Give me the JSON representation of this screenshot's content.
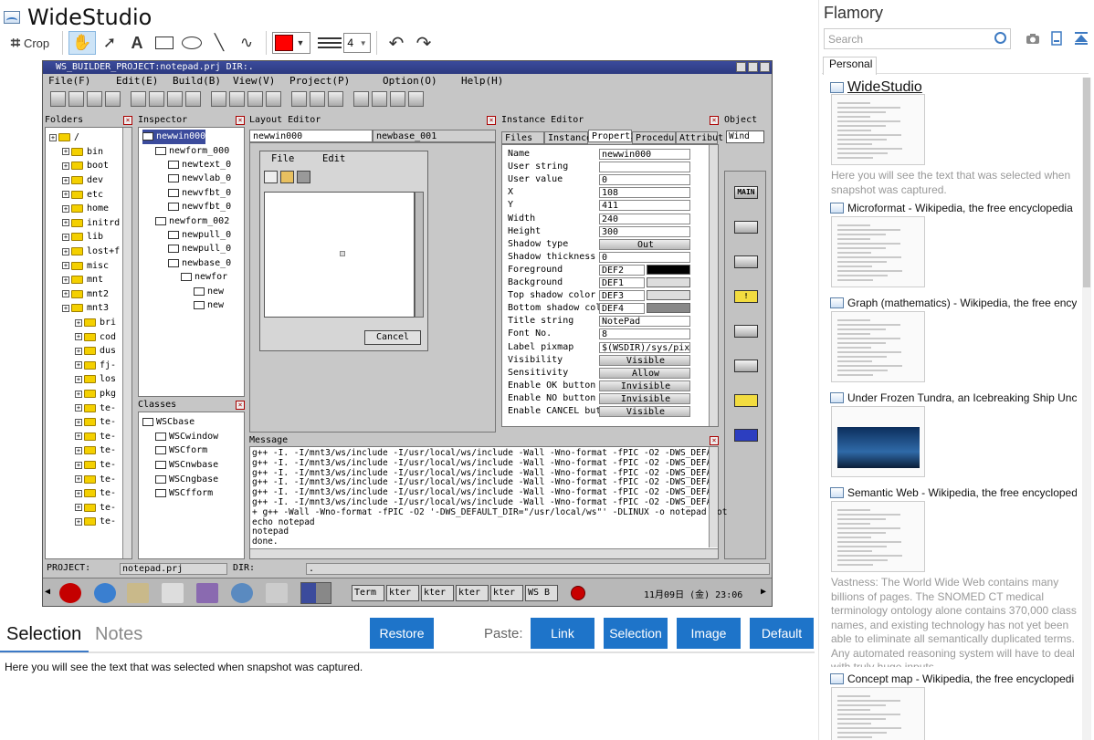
{
  "app": {
    "title": "WideStudio"
  },
  "toolbar": {
    "crop_label": "Crop",
    "line_width": "4",
    "tools": [
      "hand-tool",
      "pointer-tool",
      "text-tool",
      "rectangle-tool",
      "ellipse-tool",
      "line-tool",
      "lasso-tool"
    ],
    "color": "#ff0000"
  },
  "screenshot": {
    "window_title": "WS_BUILDER_PROJECT:notepad.prj DIR:.",
    "menu": [
      "File(F)",
      "Edit(E)",
      "Build(B)",
      "View(V)",
      "Project(P)",
      "Option(O)",
      "Help(H)"
    ],
    "folders": {
      "title": "Folders",
      "items": [
        "/",
        "bin",
        "boot",
        "dev",
        "etc",
        "home",
        "initrd",
        "lib",
        "lost+f",
        "misc",
        "mnt",
        "mnt2",
        "mnt3",
        "bri",
        "cod",
        "dus",
        "fj-",
        "los",
        "pkg",
        "te-",
        "te-",
        "te-",
        "te-",
        "te-",
        "te-",
        "te-",
        "te-",
        "te-"
      ]
    },
    "inspector": {
      "title": "Inspector",
      "items": [
        "newwin000",
        "newform_000",
        "newtext_0",
        "newvlab_0",
        "newvfbt_0",
        "newvfbt_0",
        "newform_002",
        "newpull_0",
        "newpull_0",
        "newbase_0",
        "newfor",
        "new",
        "new"
      ]
    },
    "classes": {
      "title": "Classes",
      "items": [
        "WSCbase",
        "WSCwindow",
        "WSCform",
        "WSCnwbase",
        "WSCngbase",
        "WSCfform"
      ]
    },
    "layout_editor": {
      "title": "Layout Editor",
      "tabs": [
        "newwin000",
        "newbase_001"
      ],
      "menu": [
        "File",
        "Edit"
      ],
      "cancel_label": "Cancel"
    },
    "instance_editor": {
      "title": "Instance Editor",
      "tabs": [
        "Files",
        "Instance",
        "Properti",
        "Procedur",
        "Attribut"
      ],
      "props": [
        {
          "k": "Name",
          "v": "newwin000"
        },
        {
          "k": "User string",
          "v": ""
        },
        {
          "k": "User value",
          "v": "0"
        },
        {
          "k": "X",
          "v": "108"
        },
        {
          "k": "Y",
          "v": "411"
        },
        {
          "k": "Width",
          "v": "240"
        },
        {
          "k": "Height",
          "v": "300"
        },
        {
          "k": "Shadow type",
          "v": "Out"
        },
        {
          "k": "Shadow thickness",
          "v": "0"
        },
        {
          "k": "Foreground",
          "v": "DEF2"
        },
        {
          "k": "Background",
          "v": "DEF1"
        },
        {
          "k": "Top shadow color",
          "v": "DEF3"
        },
        {
          "k": "Bottom shadow color",
          "v": "DEF4"
        },
        {
          "k": "Title string",
          "v": "NotePad"
        },
        {
          "k": "Font No.",
          "v": "8"
        },
        {
          "k": "Label pixmap",
          "v": "$(WSDIR)/sys/pix"
        },
        {
          "k": "Visibility",
          "v": "Visible"
        },
        {
          "k": "Sensitivity",
          "v": "Allow"
        },
        {
          "k": "Enable OK button",
          "v": "Invisible"
        },
        {
          "k": "Enable NO button",
          "v": "Invisible"
        },
        {
          "k": "Enable CANCEL butt",
          "v": "Visible"
        }
      ]
    },
    "object": {
      "title": "Object",
      "select": "Wind",
      "main_label": "MAIN"
    },
    "message": {
      "title": "Message",
      "lines": [
        "g++ -I. -I/mnt3/ws/include -I/usr/local/ws/include  -Wall -Wno-format -fPIC -O2  -DWS_DEFAU",
        "g++ -I. -I/mnt3/ws/include -I/usr/local/ws/include  -Wall -Wno-format -fPIC -O2  -DWS_DEFAU",
        "g++ -I. -I/mnt3/ws/include -I/usr/local/ws/include  -Wall -Wno-format -fPIC -O2  -DWS_DEFAU",
        "g++ -I. -I/mnt3/ws/include -I/usr/local/ws/include  -Wall -Wno-format -fPIC -O2  -DWS_DEFAU",
        "g++ -I. -I/mnt3/ws/include -I/usr/local/ws/include  -Wall -Wno-format -fPIC -O2  -DWS_DEFAU",
        "g++ -I. -I/mnt3/ws/include -I/usr/local/ws/include  -Wall -Wno-format -fPIC -O2  -DWS_DEFAU",
        "+ g++ -Wall -Wno-format -fPIC -O2 '-DWS_DEFAULT_DIR=\"/usr/local/ws\"' -DLINUX -o notepad not",
        "echo notepad",
        "notepad",
        "done."
      ]
    },
    "status": {
      "project_label": "PROJECT:",
      "project_value": "notepad.prj",
      "dir_label": "DIR:",
      "dir_value": "."
    },
    "taskbar": {
      "buttons": [
        "Term",
        "kter",
        "kter",
        "kter",
        "kter",
        "WS B"
      ],
      "clock": "11月09日 (金) 23:06"
    }
  },
  "bottom": {
    "tabs": [
      "Selection",
      "Notes"
    ],
    "restore_label": "Restore",
    "paste_label": "Paste:",
    "paste_buttons": [
      "Link",
      "Selection",
      "Image",
      "Default"
    ],
    "selection_text": "Here you will see the text that was selected when snapshot was captured."
  },
  "flamory": {
    "title": "Flamory",
    "search_placeholder": "Search",
    "tab": "Personal",
    "entries": [
      {
        "title": "WideStudio",
        "desc": "Here you will see the text that was selected when snapshot was captured."
      },
      {
        "title": "Microformat - Wikipedia, the free encyclopedia",
        "desc": ""
      },
      {
        "title": "Graph (mathematics) - Wikipedia, the free ency",
        "desc": ""
      },
      {
        "title": "Under Frozen Tundra, an Icebreaking Ship Unco",
        "desc": ""
      },
      {
        "title": "Semantic Web - Wikipedia, the free encycloped",
        "desc": "Vastness: The World Wide Web contains many billions of pages. The SNOMED CT medical terminology ontology alone contains 370,000 class names, and existing technology has not yet been able to eliminate all semantically duplicated terms. Any automated reasoning system will have to deal with truly huge inputs."
      },
      {
        "title": "Concept map - Wikipedia, the free encyclopedi",
        "desc": ""
      }
    ]
  }
}
